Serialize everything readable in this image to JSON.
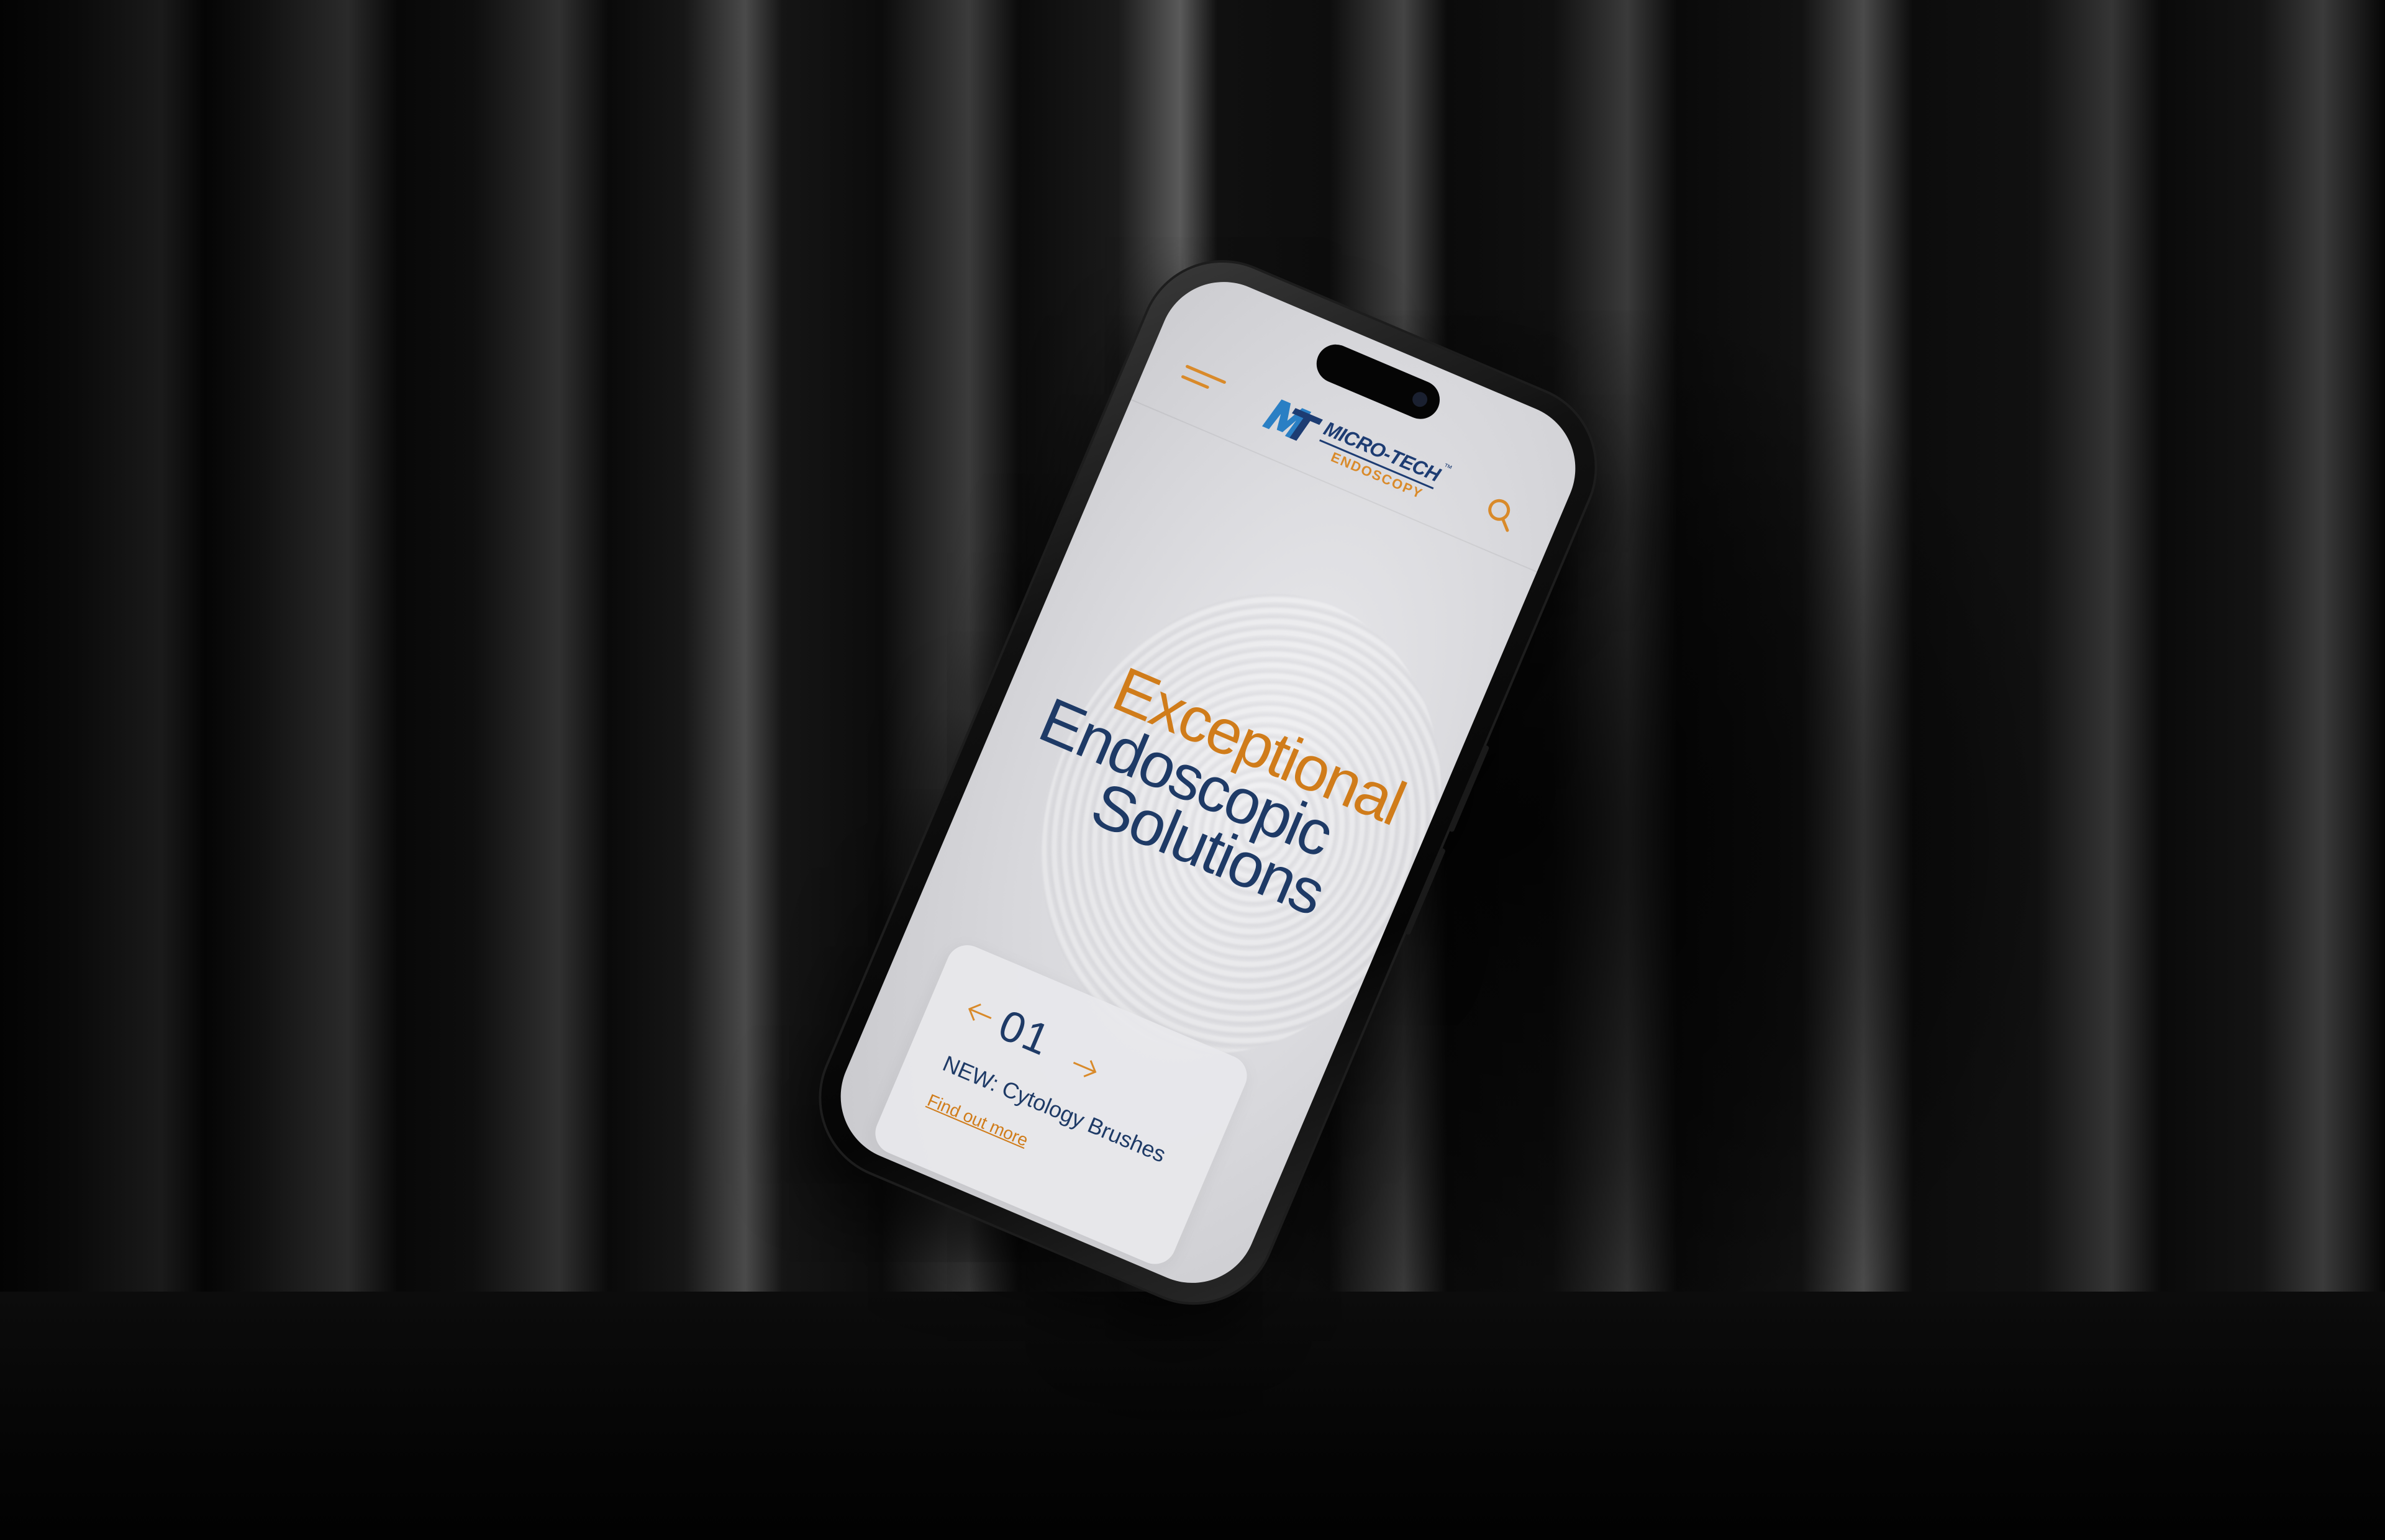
{
  "brand": {
    "name_line1": "MICRO-TECH",
    "name_line2": "ENDOSCOPY",
    "trademark": "™",
    "mark": "MT",
    "colors": {
      "orange": "#d07c1a",
      "navy": "#1e3a66"
    }
  },
  "header": {
    "menu_icon": "hamburger-menu-icon",
    "search_icon": "search-icon"
  },
  "hero": {
    "line1": "Exceptional",
    "line2": "Endoscopic",
    "line3": "Solutions"
  },
  "slider": {
    "counter": "01",
    "prev_icon": "arrow-left-icon",
    "next_icon": "arrow-right-icon",
    "title": "NEW: Cytology Brushes",
    "link_text": "Find out more"
  }
}
